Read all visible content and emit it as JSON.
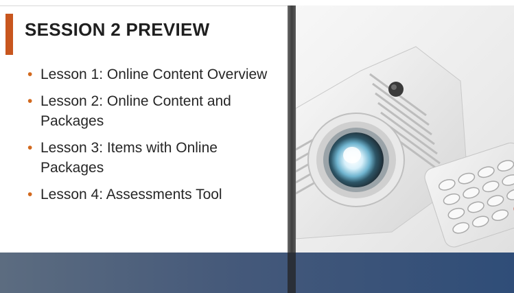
{
  "slide": {
    "title": "SESSION 2 PREVIEW",
    "bullets": [
      {
        "marker": "•",
        "text": "Lesson 1: Online Content Overview"
      },
      {
        "marker": "•",
        "text": "Lesson 2: Online Content and Packages"
      },
      {
        "marker": "•",
        "text": "Lesson 3: Items with Online Packages"
      },
      {
        "marker": "•",
        "text": "Lesson 4: Assessments Tool"
      }
    ]
  },
  "colors": {
    "accent": "#c8561e",
    "bullet_marker": "#d2691e",
    "title_text": "#1f1f1f",
    "footer_band": "#2f4d78"
  },
  "image": {
    "subject": "projector-and-remote-photo"
  }
}
